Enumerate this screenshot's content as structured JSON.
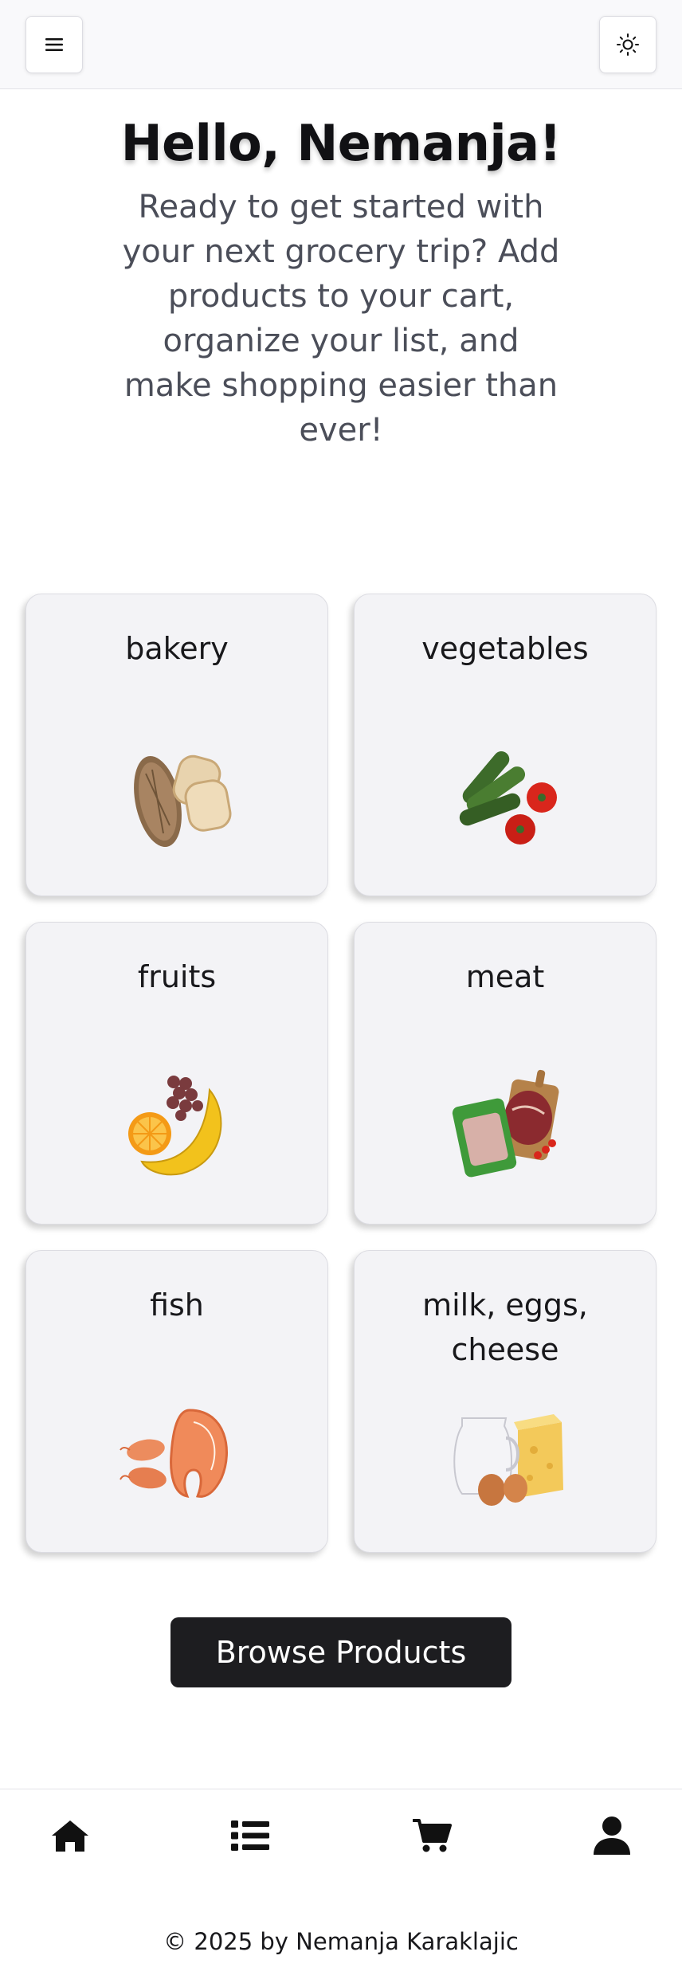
{
  "header": {
    "menu_icon": "hamburger-menu-icon",
    "theme_icon": "sun-icon"
  },
  "greeting": {
    "title": "Hello, Nemanja!",
    "subtitle": "Ready to get started with your next grocery trip? Add products to your cart, organize your list, and make shopping easier than ever!"
  },
  "categories": [
    {
      "label": "bakery",
      "icon": "bread-image"
    },
    {
      "label": "vegetables",
      "icon": "cucumber-tomato-image"
    },
    {
      "label": "fruits",
      "icon": "banana-orange-grapes-image"
    },
    {
      "label": "meat",
      "icon": "meat-steak-image"
    },
    {
      "label": "fish",
      "icon": "salmon-shrimp-image"
    },
    {
      "label": "milk, eggs, cheese",
      "icon": "milk-eggs-cheese-image"
    }
  ],
  "browse_button": {
    "label": "Browse Products"
  },
  "bottom_nav": [
    {
      "icon": "home-icon"
    },
    {
      "icon": "list-icon"
    },
    {
      "icon": "cart-icon"
    },
    {
      "icon": "user-icon"
    }
  ],
  "footer": {
    "text": "© 2025 by Nemanja Karaklajic"
  },
  "colors": {
    "primary_button": "#1d1d20",
    "card_background": "#f3f3f6",
    "header_background": "#f9f9fb",
    "subtitle_text": "#4b4e59"
  }
}
